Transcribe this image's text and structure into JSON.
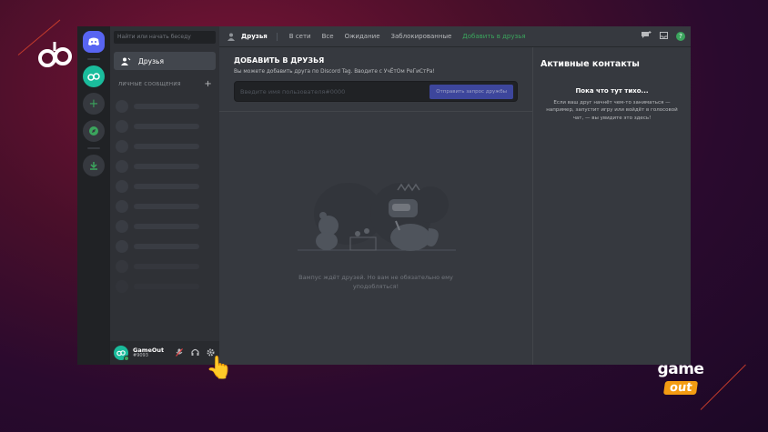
{
  "app": {
    "search_placeholder": "Найти или начать беседу",
    "friends_nav_label": "Друзья",
    "dm_header": "ЛИЧНЫЕ СООБЩЕНИЯ",
    "dm_add": "+",
    "user": {
      "name": "GameOut",
      "tag": "#9093"
    }
  },
  "topbar": {
    "title": "Друзья",
    "tabs": [
      "В сети",
      "Все",
      "Ожидание",
      "Заблокированные"
    ],
    "add_friend_tab": "Добавить в друзья"
  },
  "add_friend": {
    "title": "ДОБАВИТЬ В ДРУЗЬЯ",
    "description": "Вы можете добавить друга по Discord Tag. Вводите с УчЁтОм РеГиСтРа!",
    "placeholder": "Введите имя пользователя#0000",
    "button": "Отправить запрос дружбы"
  },
  "empty_state": {
    "line1": "Вампус ждёт друзей. Но вам не обязательно ему",
    "line2": "уподобляться!"
  },
  "active_now": {
    "title": "Активные контакты",
    "empty_title": "Пока что тут тихо...",
    "empty_desc": "Если ваш друг начнёт чем-то заниматься — например, запустит игру или войдёт в голосовой чат, — вы увидите это здесь!"
  },
  "brand": {
    "line1": "game",
    "line2": "out"
  },
  "colors": {
    "accent": "#5865f2",
    "online": "#3ba55d",
    "brand_orange": "#f39c12"
  }
}
